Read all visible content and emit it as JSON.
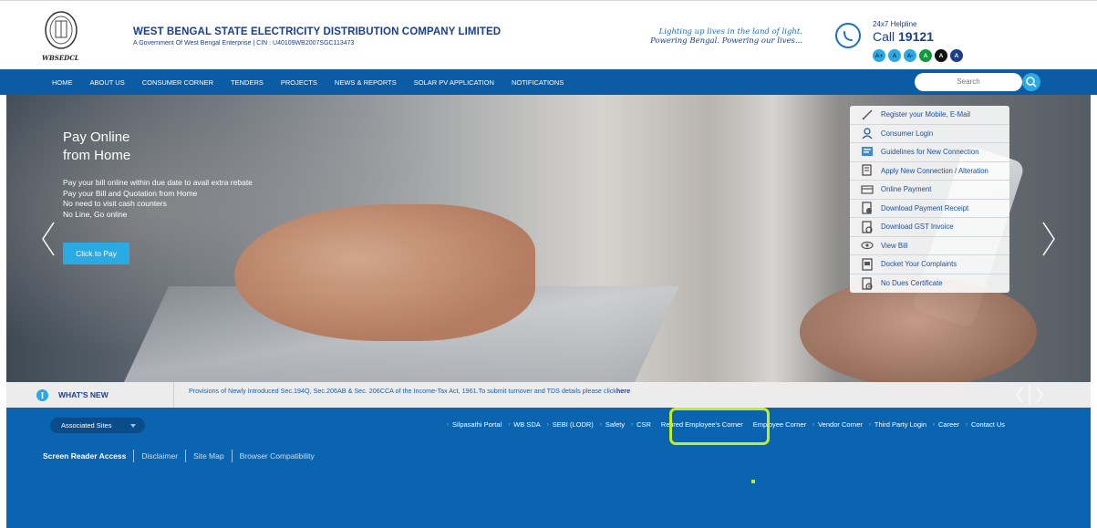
{
  "header": {
    "logo_text": "WBSEDCL",
    "company_name": "WEST BENGAL STATE ELECTRICITY DISTRIBUTION COMPANY LIMITED",
    "company_sub": "A Government Of West Bengal Enterprise | CIN : U40109WB2007SGC113473",
    "tagline_line1": "Lighting up lives in the land of light.",
    "tagline_line2": "Powering Bengal. Powering our lives...",
    "helpline_label": "24x7 Helpline",
    "helpline_call": "Call",
    "helpline_number": "19121",
    "font_buttons": [
      "A+",
      "A",
      "A-",
      "A",
      "A",
      "A"
    ]
  },
  "nav": {
    "items": [
      "HOME",
      "ABOUT US",
      "CONSUMER CORNER",
      "TENDERS",
      "PROJECTS",
      "NEWS & REPORTS",
      "SOLAR PV APPLICATION",
      "NOTIFICATIONS"
    ],
    "search_placeholder": "Search"
  },
  "hero": {
    "title_line1": "Pay Online",
    "title_line2": "from Home",
    "lines": [
      "Pay your bill online within due date to avail extra rebate",
      "Pay your Bill and Quotation from Home",
      "No need to visit cash counters",
      "No Line, Go online"
    ],
    "button": "Click to Pay"
  },
  "quick_links": [
    {
      "label": "Register your Mobile, E-Mail",
      "icon": "pencil-icon"
    },
    {
      "label": "Consumer Login",
      "icon": "user-icon"
    },
    {
      "label": "Guidelines for New Connection",
      "icon": "guidelines-icon"
    },
    {
      "label": "Apply New Connection / Alteration",
      "icon": "apply-icon"
    },
    {
      "label": "Online Payment",
      "icon": "card-icon"
    },
    {
      "label": "Download Payment Receipt",
      "icon": "receipt-icon"
    },
    {
      "label": "Download GST Invoice",
      "icon": "invoice-icon"
    },
    {
      "label": "View Bill",
      "icon": "eye-icon"
    },
    {
      "label": "Docket Your Complaints",
      "icon": "docket-icon"
    },
    {
      "label": "No Dues Certificate",
      "icon": "certificate-icon"
    }
  ],
  "news": {
    "label": "WHAT'S NEW",
    "text": "Provisions of Newly Introduced Sec.194Q, Sec.206AB & Sec. 206CCA of the Income-Tax Act, 1961.To submit turnover and TDS details please click",
    "link": "here"
  },
  "footer": {
    "associated_sites": "Associated Sites",
    "links": [
      "Silpasathi Portal",
      "WB SDA",
      "SEBI (LODR)",
      "Safety",
      "CSR",
      "Retired Employee's Corner",
      "Employee Corner",
      "Vendor Corner",
      "Third Party Login",
      "Career",
      "Contact Us"
    ],
    "bottom_links": [
      "Screen Reader Access",
      "Disclaimer",
      "Site Map",
      "Browser Compatibility"
    ]
  },
  "colors": {
    "nav_blue": "#0b5ca5",
    "footer_blue": "#0b64b0",
    "accent_cyan": "#2aa9e2",
    "highlight": "#c4ef1e"
  }
}
